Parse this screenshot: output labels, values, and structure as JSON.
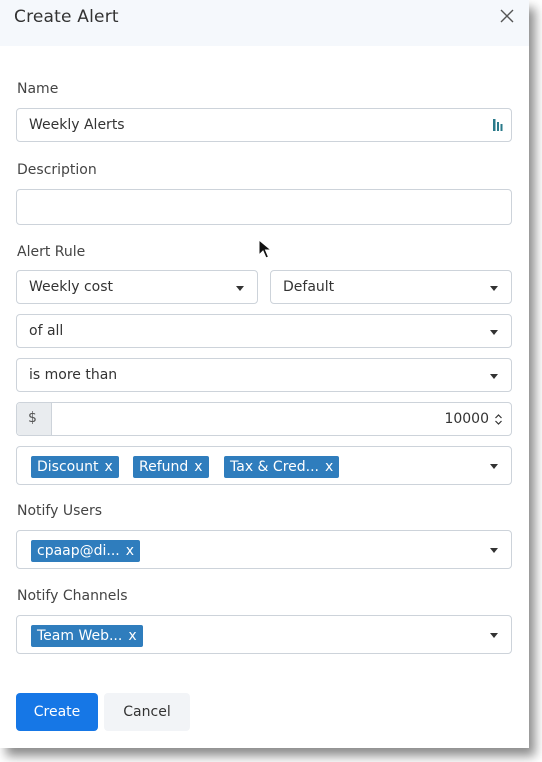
{
  "modal": {
    "title": "Create Alert"
  },
  "name": {
    "label": "Name",
    "value": "Weekly Alerts"
  },
  "description": {
    "label": "Description",
    "value": ""
  },
  "alert_rule": {
    "label": "Alert Rule",
    "metric": "Weekly cost",
    "scope": "Default",
    "of": "of all",
    "comparator": "is more than",
    "currency": "$",
    "threshold": "10000",
    "exclusions": [
      "Discount",
      "Refund",
      "Tax & Cred..."
    ]
  },
  "notify_users": {
    "label": "Notify Users",
    "values": [
      "cpaap@di..."
    ]
  },
  "notify_channels": {
    "label": "Notify Channels",
    "values": [
      "Team Web..."
    ]
  },
  "actions": {
    "create": "Create",
    "cancel": "Cancel"
  },
  "tag_remove": "x",
  "colors": {
    "primary": "#1677e6",
    "tag": "#2f7dbd",
    "header_bg": "#f5f8fc"
  }
}
